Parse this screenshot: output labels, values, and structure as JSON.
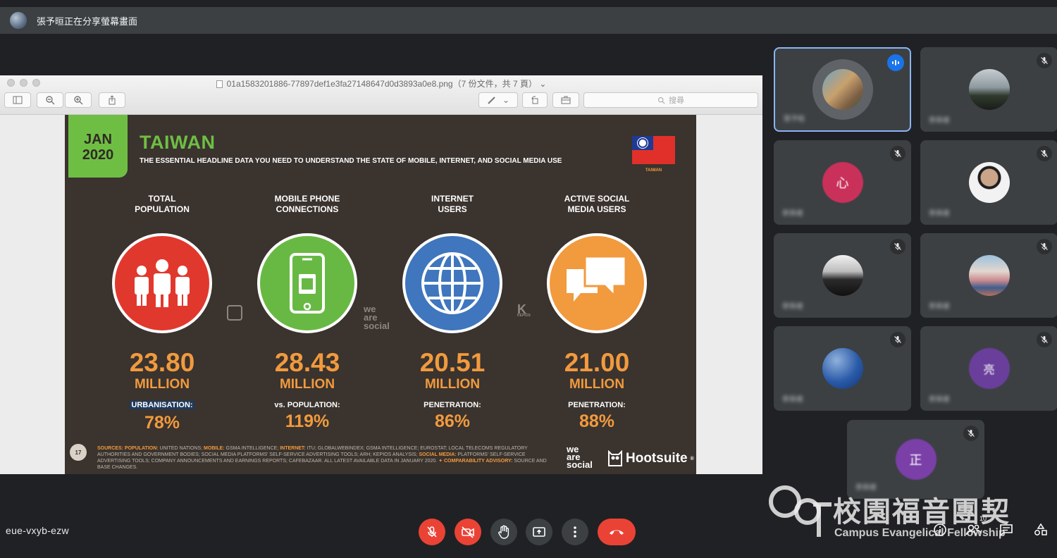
{
  "banner": {
    "text": "張予晅正在分享螢幕畫面"
  },
  "shared_window": {
    "filename": "01a1583201886-77897def1e3fa27148647d0d3893a0e8.png",
    "file_info": "（7 份文件，共 7 頁）",
    "search_placeholder": "搜尋"
  },
  "slide": {
    "date": [
      "JAN",
      "2020"
    ],
    "title": "TAIWAN",
    "subtitle": "THE ESSENTIAL HEADLINE DATA YOU NEED TO UNDERSTAND THE STATE OF MOBILE, INTERNET, AND SOCIAL MEDIA USE",
    "flag_caption": "TAIWAN",
    "page_number": "17",
    "stats": [
      {
        "label": [
          "TOTAL",
          "POPULATION"
        ],
        "value": "23.80",
        "unit": "MILLION",
        "sub_label": "URBANISATION:",
        "sub_value": "78%",
        "color": "#e1382e",
        "icon": "people-icon"
      },
      {
        "label": [
          "MOBILE PHONE",
          "CONNECTIONS"
        ],
        "value": "28.43",
        "unit": "MILLION",
        "sub_label": "vs. POPULATION:",
        "sub_value": "119%",
        "color": "#68b944",
        "icon": "mobile-phone-icon"
      },
      {
        "label": [
          "INTERNET",
          "USERS"
        ],
        "value": "20.51",
        "unit": "MILLION",
        "sub_label": "PENETRATION:",
        "sub_value": "86%",
        "color": "#3f76bd",
        "icon": "globe-icon"
      },
      {
        "label": [
          "ACTIVE SOCIAL",
          "MEDIA USERS"
        ],
        "value": "21.00",
        "unit": "MILLION",
        "sub_label": "PENETRATION:",
        "sub_value": "88%",
        "color": "#f19a3e",
        "icon": "chat-bubbles-icon"
      }
    ],
    "sources": [
      {
        "t": "SOURCES:",
        "o": true
      },
      {
        "t": " "
      },
      {
        "t": "POPULATION:",
        "o": true
      },
      {
        "t": " UNITED NATIONS; "
      },
      {
        "t": "MOBILE:",
        "o": true
      },
      {
        "t": " GSMA INTELLIGENCE; "
      },
      {
        "t": "INTERNET:",
        "o": true
      },
      {
        "t": " ITU; GLOBALWEBINDEX; GSMA INTELLIGENCE; EUROSTAT; LOCAL TELECOMS REGULATORY AUTHORITIES AND GOVERNMENT BODIES; SOCIAL MEDIA PLATFORMS' SELF-SERVICE ADVERTISING TOOLS; ARH; KEPIOS ANALYSIS; "
      },
      {
        "t": "SOCIAL MEDIA:",
        "o": true
      },
      {
        "t": " PLATFORMS' SELF-SERVICE ADVERTISING TOOLS; COMPANY ANNOUNCEMENTS AND EARNINGS REPORTS; CAFEBAZAAR. ALL LATEST AVAILABLE DATA IN JANUARY 2020. "
      },
      {
        "t": "✦ COMPARABILITY ADVISORY:",
        "o": true
      },
      {
        "t": " SOURCE AND BASE CHANGES."
      }
    ],
    "brand_was": [
      "we",
      "are",
      "social"
    ],
    "brand_hootsuite": "Hootsuite",
    "brand_mark": "®",
    "kepios": "KEPIOS"
  },
  "participants": [
    {
      "name": "張予晅",
      "state": "speaking",
      "avatar_color": "#7a6a5a"
    },
    {
      "name": "參與者",
      "state": "muted",
      "avatar_color": "#555d63"
    },
    {
      "name": "參與者",
      "state": "muted",
      "avatar_color": "#c9315a",
      "initial": "心"
    },
    {
      "name": "參與者",
      "state": "muted",
      "avatar_color": "#e9e9e9"
    },
    {
      "name": "參與者",
      "state": "muted",
      "avatar_color": "#3b3b3b"
    },
    {
      "name": "參與者",
      "state": "muted",
      "avatar_color": "#6d8fb3"
    },
    {
      "name": "參與者",
      "state": "muted",
      "avatar_color": "#2a5aa8"
    },
    {
      "name": "參與者",
      "state": "muted",
      "avatar_color": "#6a3f9c",
      "initial": "亮"
    },
    {
      "name": "參與者",
      "state": "muted",
      "avatar_color": "#7b3fa8",
      "initial": "正"
    }
  ],
  "meeting": {
    "code": "eue-vxyb-ezw",
    "participant_count": "10"
  },
  "watermark": {
    "cn": "校園福音團契",
    "en": "Campus Evangelical Fellowship"
  }
}
